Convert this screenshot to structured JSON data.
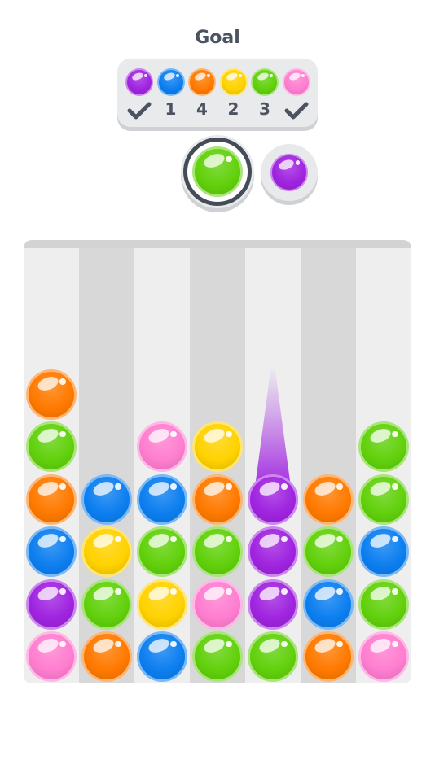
{
  "goal": {
    "title": "Goal",
    "items": [
      {
        "color": "purple",
        "count": "",
        "done": true
      },
      {
        "color": "blue",
        "count": "1",
        "done": false
      },
      {
        "color": "orange",
        "count": "4",
        "done": false
      },
      {
        "color": "yellow",
        "count": "2",
        "done": false
      },
      {
        "color": "green",
        "count": "3",
        "done": false
      },
      {
        "color": "pink",
        "count": "",
        "done": true
      }
    ]
  },
  "current_ball": "green",
  "next_ball": "purple",
  "colors": {
    "purple": "#a024e0",
    "blue": "#0d7ff0",
    "orange": "#ff7a00",
    "yellow": "#ffd200",
    "green": "#62d10c",
    "pink": "#ff7ed0"
  },
  "board": {
    "aimed_column": 4,
    "columns": [
      [
        "pink",
        "purple",
        "blue",
        "orange",
        "green",
        "orange"
      ],
      [
        "orange",
        "green",
        "yellow",
        "blue"
      ],
      [
        "blue",
        "yellow",
        "green",
        "blue",
        "pink"
      ],
      [
        "green",
        "pink",
        "green",
        "orange",
        "yellow"
      ],
      [
        "green",
        "purple",
        "purple",
        "purple"
      ],
      [
        "orange",
        "blue",
        "green",
        "orange"
      ],
      [
        "pink",
        "green",
        "blue",
        "green",
        "green"
      ]
    ]
  }
}
